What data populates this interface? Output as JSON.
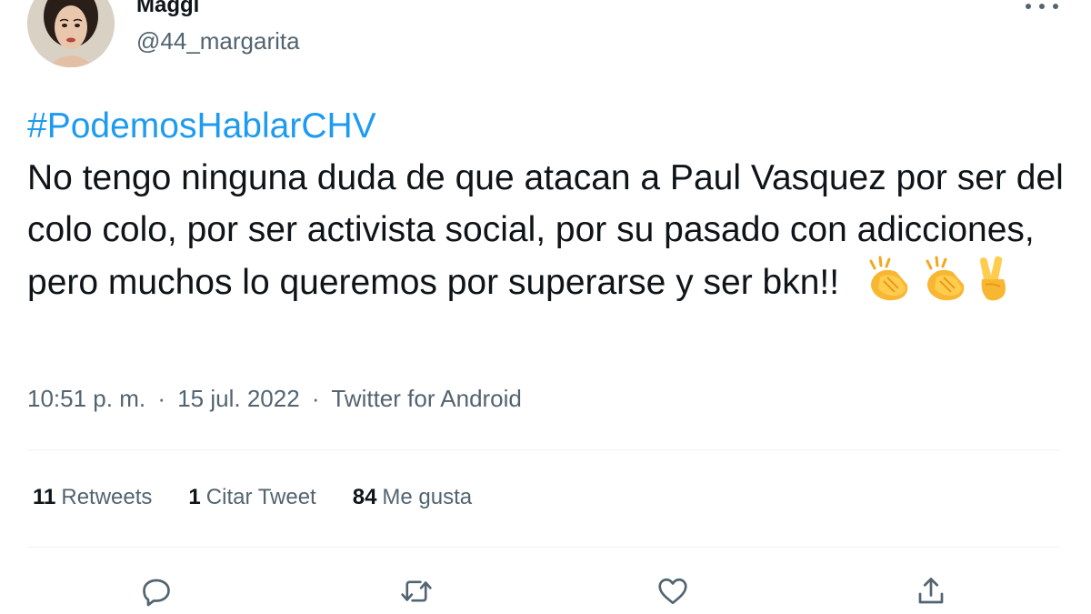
{
  "author": {
    "display_name": "Maggi",
    "handle": "@44_margarita"
  },
  "tweet": {
    "hashtag": "#PodemosHablarCHV",
    "text": "No tengo ninguna duda de que atacan a Paul Vasquez por ser del colo colo,  por ser activista social,  por su pasado con adicciones,  pero muchos lo queremos por superarse y ser bkn!!",
    "emojis": [
      "clapping-hands",
      "clapping-hands",
      "victory-hand"
    ]
  },
  "meta": {
    "time": "10:51 p. m.",
    "separator": "·",
    "date": "15 jul. 2022",
    "source": "Twitter for Android"
  },
  "stats": {
    "retweets": {
      "count": "11",
      "label": "Retweets"
    },
    "quotes": {
      "count": "1",
      "label": "Citar Tweet"
    },
    "likes": {
      "count": "84",
      "label": "Me gusta"
    }
  },
  "actions": [
    "reply-icon",
    "retweet-icon",
    "like-icon",
    "share-icon"
  ],
  "colors": {
    "accent": "#1d9bf0",
    "text": "#0f1419",
    "secondary": "#536471",
    "divider": "#eff3f4"
  }
}
